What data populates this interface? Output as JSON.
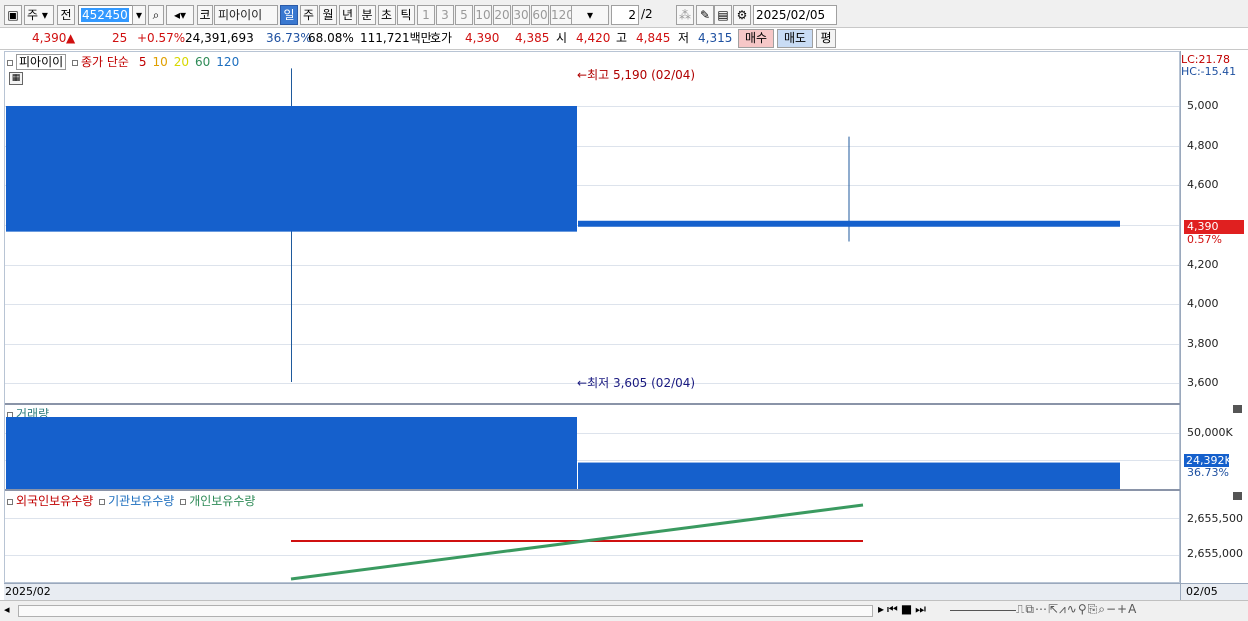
{
  "toolbar": {
    "period_main": "주",
    "prev_label": "전",
    "ticker_code": "452450",
    "market_label": "코",
    "stock_name": "피아이이",
    "periods": [
      "일",
      "주",
      "월",
      "년",
      "분",
      "초",
      "틱"
    ],
    "active_period": "일",
    "intervals": [
      "1",
      "3",
      "5",
      "10",
      "20",
      "30",
      "60",
      "120"
    ],
    "page_value": "2",
    "page_total": "/2",
    "date": "2025/02/05"
  },
  "infobar": {
    "price": "4,390",
    "change": "25",
    "change_pct": "+0.57%",
    "volume": "24,391,693",
    "vol_ratio": "36.73%",
    "ratio2": "68.08%",
    "amount": "111,721백만",
    "hoga_label": "호가",
    "ask": "4,390",
    "bid": "4,385",
    "open_label": "시",
    "open": "4,420",
    "high_label": "고",
    "high": "4,845",
    "low_label": "저",
    "low": "4,315",
    "buy_btn": "매수",
    "sell_btn": "매도",
    "eval_btn": "평"
  },
  "price_pane": {
    "legend_name": "피아이이",
    "legend_ma": "종가 단순",
    "ma_periods": [
      "5",
      "10",
      "20",
      "60",
      "120"
    ],
    "ma_colors": [
      "#c00000",
      "#e0a000",
      "#d8d800",
      "#2e8b57",
      "#1e6fbf"
    ],
    "high_marker": "최고 5,190 (02/04)",
    "low_marker": "최저 3,605 (02/04)",
    "lc": "LC:21.78",
    "hc": "HC:-15.41",
    "yticks": [
      "5,000",
      "4,800",
      "4,600",
      "4,400",
      "4,200",
      "4,000",
      "3,800",
      "3,600"
    ],
    "current_price": "4,390",
    "current_pct": "0.57%"
  },
  "volume_pane": {
    "legend_name": "거래량",
    "ytick": "50,000K",
    "current_vol": "24,392K",
    "current_pct": "36.73%"
  },
  "holder_pane": {
    "legend": [
      "외국인보유수량",
      "기관보유수량",
      "개인보유수량"
    ],
    "legend_colors": [
      "#c00000",
      "#1e6fbf",
      "#2e8b57"
    ],
    "yticks": [
      "2,655,500",
      "2,655,000"
    ]
  },
  "xaxis": {
    "left_label": "2025/02",
    "right_label": "02/05"
  },
  "chart_data": {
    "type": "candlestick",
    "candles": [
      {
        "date": "02/04",
        "open": 5000,
        "close": 4365,
        "high": 5190,
        "low": 3605,
        "volume": 66400
      },
      {
        "date": "02/05",
        "open": 4420,
        "close": 4390,
        "high": 4845,
        "low": 4315,
        "volume": 24392
      }
    ],
    "colors": {
      "up": "#1560cc",
      "down": "#1560cc",
      "current": "#e02020"
    }
  }
}
